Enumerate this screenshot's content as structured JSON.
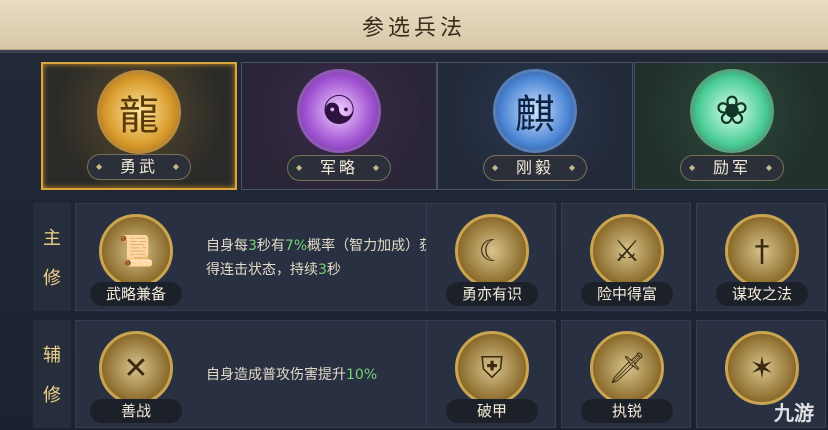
{
  "header": {
    "title": "参选兵法"
  },
  "categories": [
    {
      "label": "勇武",
      "icon": "golden-beast-emblem-icon",
      "selected": true
    },
    {
      "label": "军略",
      "icon": "yin-yang-bagua-emblem-icon",
      "selected": false
    },
    {
      "label": "刚毅",
      "icon": "blue-beast-emblem-icon",
      "selected": false
    },
    {
      "label": "励军",
      "icon": "jade-gourd-emblem-icon",
      "selected": false
    }
  ],
  "main": {
    "label_top": "主",
    "label_bottom": "修",
    "equipped": {
      "name": "武略兼备",
      "icon": "scroll-shield-icon",
      "desc_parts": [
        "自身每",
        "3",
        "秒有",
        "7%",
        "概率（智力加成）获得连击状态，持续",
        "3",
        "秒"
      ]
    },
    "options": [
      {
        "name": "勇亦有识",
        "icon": "crescent-star-icon"
      },
      {
        "name": "险中得富",
        "icon": "swords-ring-icon"
      },
      {
        "name": "谋攻之法",
        "icon": "three-swords-icon"
      }
    ]
  },
  "sub": {
    "label_top": "辅",
    "label_bottom": "修",
    "equipped": {
      "name": "善战",
      "icon": "crossed-sabers-icon",
      "desc_parts": [
        "自身造成普攻伤害提升",
        "10%"
      ]
    },
    "options": [
      {
        "name": "破甲",
        "icon": "armor-icon"
      },
      {
        "name": "执锐",
        "icon": "blade-icon"
      }
    ]
  },
  "watermark": "九游",
  "colors": {
    "accent_gold": "#d9a53c",
    "highlight_green": "#79d27a",
    "label_gold": "#f2d28a"
  }
}
